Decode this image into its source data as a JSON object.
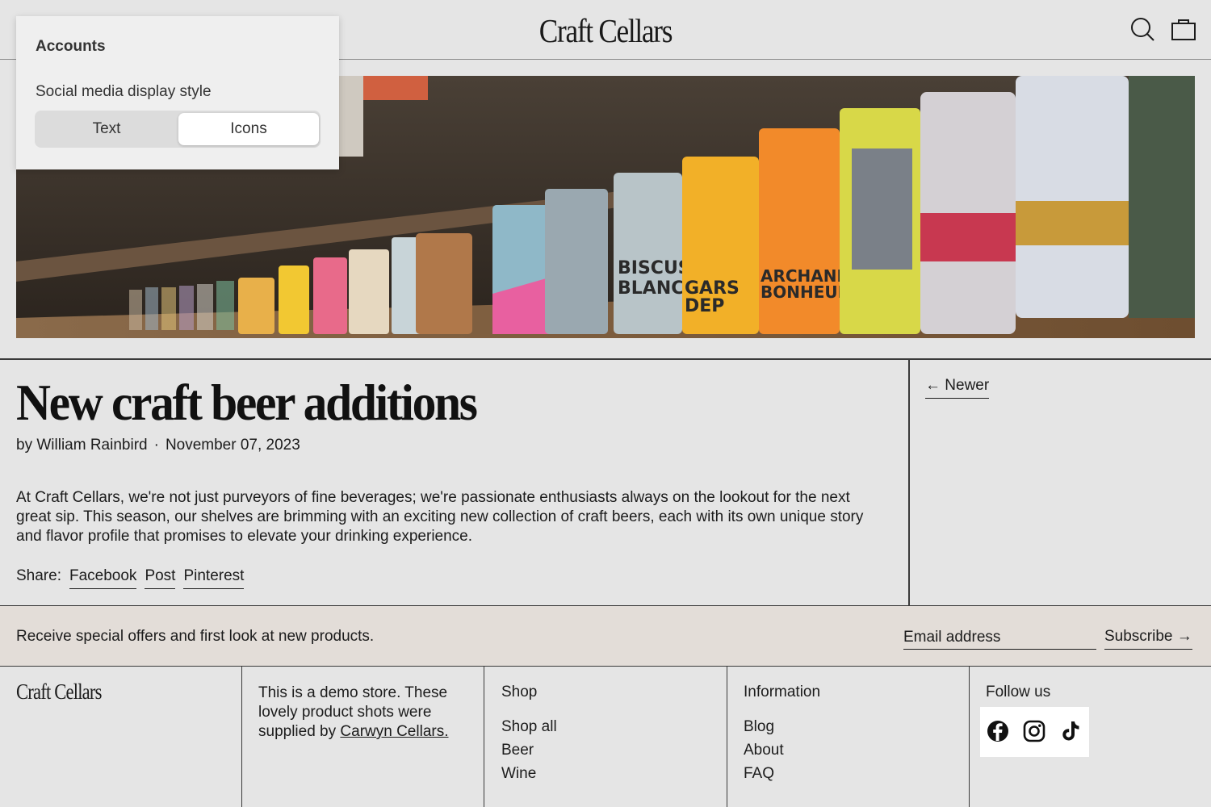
{
  "header": {
    "logo": "Craft Cellars",
    "icons": [
      "search-icon",
      "cart-icon"
    ]
  },
  "settings_panel": {
    "title": "Accounts",
    "label": "Social media display style",
    "options": [
      "Text",
      "Icons"
    ],
    "selected": "Icons"
  },
  "article": {
    "title": "New craft beer additions",
    "author": "by William Rainbird",
    "separator": "·",
    "date": "November 07, 2023",
    "body": "At Craft Cellars, we're not just purveyors of fine beverages; we're passionate enthusiasts always on the lookout for the next great sip. This season, our shelves are brimming with an exciting new collection of craft beers, each with its own unique story and flavor profile that promises to elevate your drinking experience.",
    "share_label": "Share:",
    "share_links": [
      "Facebook",
      "Post",
      "Pinterest"
    ],
    "newer_link": "← Newer"
  },
  "newsletter": {
    "message": "Receive special offers and first look at new products.",
    "email_placeholder": "Email address",
    "subscribe_label": "Subscribe →"
  },
  "footer": {
    "logo": "Craft Cellars",
    "demo_text": "This is a demo store. These lovely product shots were supplied by",
    "demo_link": "Carwyn Cellars.",
    "shop": {
      "heading": "Shop",
      "items": [
        "Shop all",
        "Beer",
        "Wine"
      ]
    },
    "information": {
      "heading": "Information",
      "items": [
        "Blog",
        "About",
        "FAQ"
      ]
    },
    "follow": {
      "heading": "Follow us",
      "icons": [
        "facebook-icon",
        "instagram-icon",
        "tiktok-icon"
      ]
    }
  },
  "colors": {
    "background": "#e5e5e5",
    "newsletter_background": "#e3ddd8",
    "text": "#1c1c1c"
  }
}
